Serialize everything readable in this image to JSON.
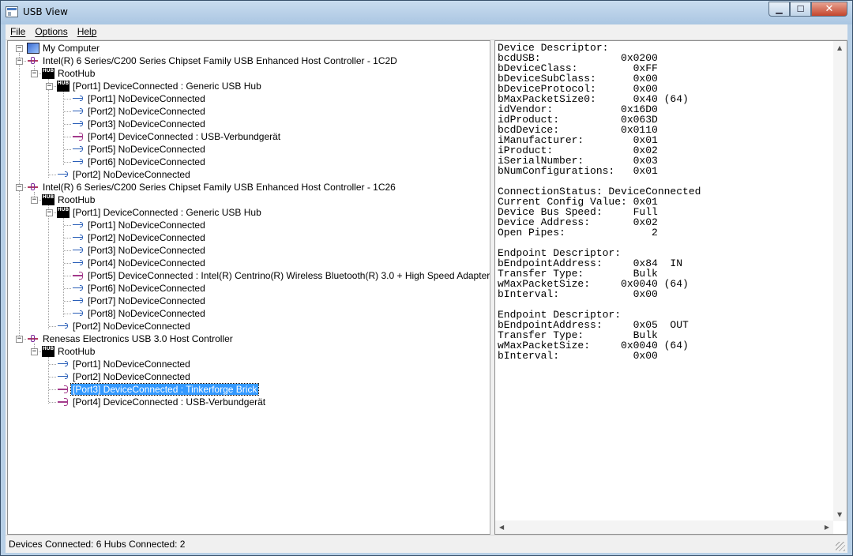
{
  "window": {
    "title": "USB View"
  },
  "menu": {
    "file": "File",
    "options": "Options",
    "help": "Help"
  },
  "tree": {
    "root": "My Computer",
    "nodes": [
      {
        "label": "Intel(R) 6 Series/C200 Series Chipset Family USB Enhanced Host Controller - 1C2D",
        "icon": "controller-icon"
      },
      {
        "label": "RootHub",
        "icon": "hub-icon"
      },
      {
        "label": "[Port1] DeviceConnected :  Generic USB Hub",
        "icon": "hub-icon"
      },
      {
        "label": "[Port1] NoDeviceConnected",
        "icon": "usb-port-icon"
      },
      {
        "label": "[Port2] NoDeviceConnected",
        "icon": "usb-port-icon"
      },
      {
        "label": "[Port3] NoDeviceConnected",
        "icon": "usb-port-icon"
      },
      {
        "label": "[Port4] DeviceConnected :  USB-Verbundgerät",
        "icon": "usb-device-icon"
      },
      {
        "label": "[Port5] NoDeviceConnected",
        "icon": "usb-port-icon"
      },
      {
        "label": "[Port6] NoDeviceConnected",
        "icon": "usb-port-icon"
      },
      {
        "label": "[Port2] NoDeviceConnected",
        "icon": "usb-port-icon"
      },
      {
        "label": "Intel(R) 6 Series/C200 Series Chipset Family USB Enhanced Host Controller - 1C26",
        "icon": "controller-icon"
      },
      {
        "label": "RootHub",
        "icon": "hub-icon"
      },
      {
        "label": "[Port1] DeviceConnected :  Generic USB Hub",
        "icon": "hub-icon"
      },
      {
        "label": "[Port1] NoDeviceConnected",
        "icon": "usb-port-icon"
      },
      {
        "label": "[Port2] NoDeviceConnected",
        "icon": "usb-port-icon"
      },
      {
        "label": "[Port3] NoDeviceConnected",
        "icon": "usb-port-icon"
      },
      {
        "label": "[Port4] NoDeviceConnected",
        "icon": "usb-port-icon"
      },
      {
        "label": "[Port5] DeviceConnected :  Intel(R) Centrino(R) Wireless Bluetooth(R) 3.0 + High Speed Adapter",
        "icon": "usb-device-icon"
      },
      {
        "label": "[Port6] NoDeviceConnected",
        "icon": "usb-port-icon"
      },
      {
        "label": "[Port7] NoDeviceConnected",
        "icon": "usb-port-icon"
      },
      {
        "label": "[Port8] NoDeviceConnected",
        "icon": "usb-port-icon"
      },
      {
        "label": "[Port2] NoDeviceConnected",
        "icon": "usb-port-icon"
      },
      {
        "label": "Renesas Electronics USB 3.0 Host Controller",
        "icon": "controller-icon"
      },
      {
        "label": "RootHub",
        "icon": "hub-icon"
      },
      {
        "label": "[Port1] NoDeviceConnected",
        "icon": "usb-port-icon"
      },
      {
        "label": "[Port2] NoDeviceConnected",
        "icon": "usb-port-icon"
      },
      {
        "label": "[Port3] DeviceConnected :  Tinkerforge Brick",
        "icon": "usb-device-icon",
        "selected": true
      },
      {
        "label": "[Port4] DeviceConnected :  USB-Verbundgerät",
        "icon": "usb-device-icon"
      }
    ]
  },
  "hub_icon_text": "HUB",
  "details": {
    "text": "Device Descriptor:\nbcdUSB:             0x0200\nbDeviceClass:         0xFF\nbDeviceSubClass:      0x00\nbDeviceProtocol:      0x00\nbMaxPacketSize0:      0x40 (64)\nidVendor:           0x16D0\nidProduct:          0x063D\nbcdDevice:          0x0110\niManufacturer:        0x01\niProduct:             0x02\niSerialNumber:        0x03\nbNumConfigurations:   0x01\n\nConnectionStatus: DeviceConnected\nCurrent Config Value: 0x01\nDevice Bus Speed:     Full\nDevice Address:       0x02\nOpen Pipes:              2\n\nEndpoint Descriptor:\nbEndpointAddress:     0x84  IN\nTransfer Type:        Bulk\nwMaxPacketSize:     0x0040 (64)\nbInterval:            0x00\n\nEndpoint Descriptor:\nbEndpointAddress:     0x05  OUT\nTransfer Type:        Bulk\nwMaxPacketSize:     0x0040 (64)\nbInterval:            0x00"
  },
  "status": {
    "text": "Devices Connected: 6   Hubs Connected: 2"
  }
}
